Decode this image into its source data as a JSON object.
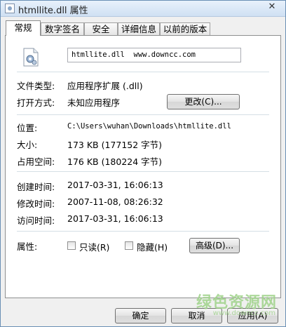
{
  "window": {
    "title": "htmllite.dll 属性",
    "close_glyph": "✕"
  },
  "tabs": [
    {
      "label": "常规",
      "active": true
    },
    {
      "label": "数字签名"
    },
    {
      "label": "安全"
    },
    {
      "label": "详细信息"
    },
    {
      "label": "以前的版本"
    }
  ],
  "general": {
    "file_name": "htmllite.dll  www.downcc.com",
    "file_icon": "dll-file-gear-icon",
    "file_type_label": "文件类型:",
    "file_type_value": "应用程序扩展 (.dll)",
    "open_with_label": "打开方式:",
    "open_with_value": "未知应用程序",
    "change_button": "更改(C)...",
    "location_label": "位置:",
    "location_value": "C:\\Users\\wuhan\\Downloads\\htmllite.dll",
    "size_label": "大小:",
    "size_value": "173 KB (177152 字节)",
    "disk_label": "占用空间:",
    "disk_value": "176 KB (180224 字节)",
    "created_label": "创建时间:",
    "created_value": "2017-03-31, 16:06:13",
    "modified_label": "修改时间:",
    "modified_value": "2007-11-08, 08:26:32",
    "accessed_label": "访问时间:",
    "accessed_value": "2017-03-31, 16:06:13",
    "attributes_label": "属性:",
    "readonly_label": "只读(R)",
    "hidden_label": "隐藏(H)",
    "advanced_button": "高级(D)..."
  },
  "footer": {
    "ok": "确定",
    "cancel": "取消",
    "apply": "应用(A)"
  },
  "watermark": {
    "text": "绿色资源网",
    "sub": "www.downcc.com"
  }
}
